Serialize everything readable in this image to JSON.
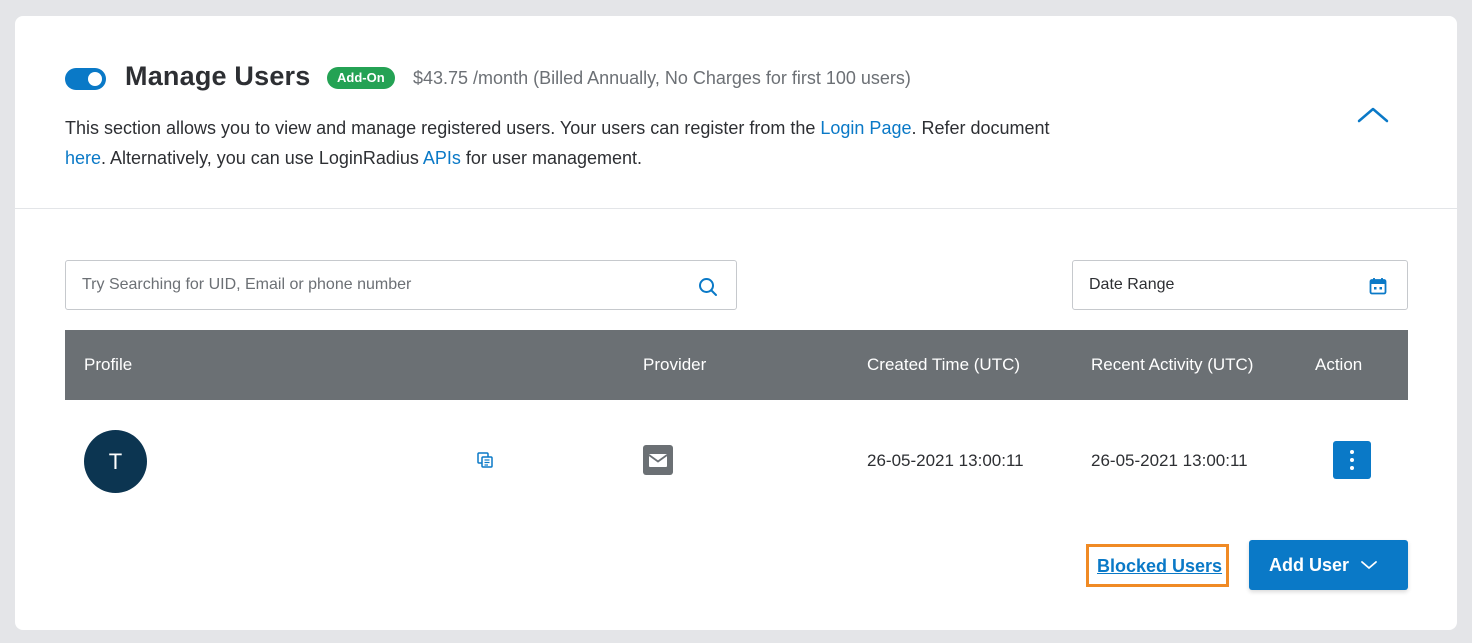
{
  "header": {
    "title": "Manage Users",
    "badge": "Add-On",
    "price": "$43.75 /month (Billed Annually, No Charges for first 100 users)",
    "desc_part1": "This section allows you to view and manage registered users. Your users can register from the ",
    "login_page_link": "Login Page",
    "desc_part2": ". Refer document ",
    "here_link": "here",
    "desc_part3": ". Alternatively, you can use LoginRadius ",
    "apis_link": "APIs",
    "desc_part4": " for user management.",
    "toggle_on": true
  },
  "search": {
    "placeholder": "Try Searching for UID, Email or phone number",
    "value": ""
  },
  "date_range": {
    "label": "Date Range"
  },
  "table": {
    "columns": {
      "profile": "Profile",
      "provider": "Provider",
      "created": "Created Time (UTC)",
      "recent": "Recent Activity (UTC)",
      "action": "Action"
    },
    "rows": [
      {
        "avatar_initial": "T",
        "provider_icon": "email-icon",
        "created": "26-05-2021 13:00:11",
        "recent": "26-05-2021 13:00:11"
      }
    ]
  },
  "footer": {
    "blocked_users": "Blocked Users",
    "add_user": "Add User"
  },
  "colors": {
    "accent": "#0a79c7",
    "badge": "#24a254",
    "table_header": "#6b7074",
    "avatar": "#0c3551",
    "highlight": "#f08a24"
  }
}
